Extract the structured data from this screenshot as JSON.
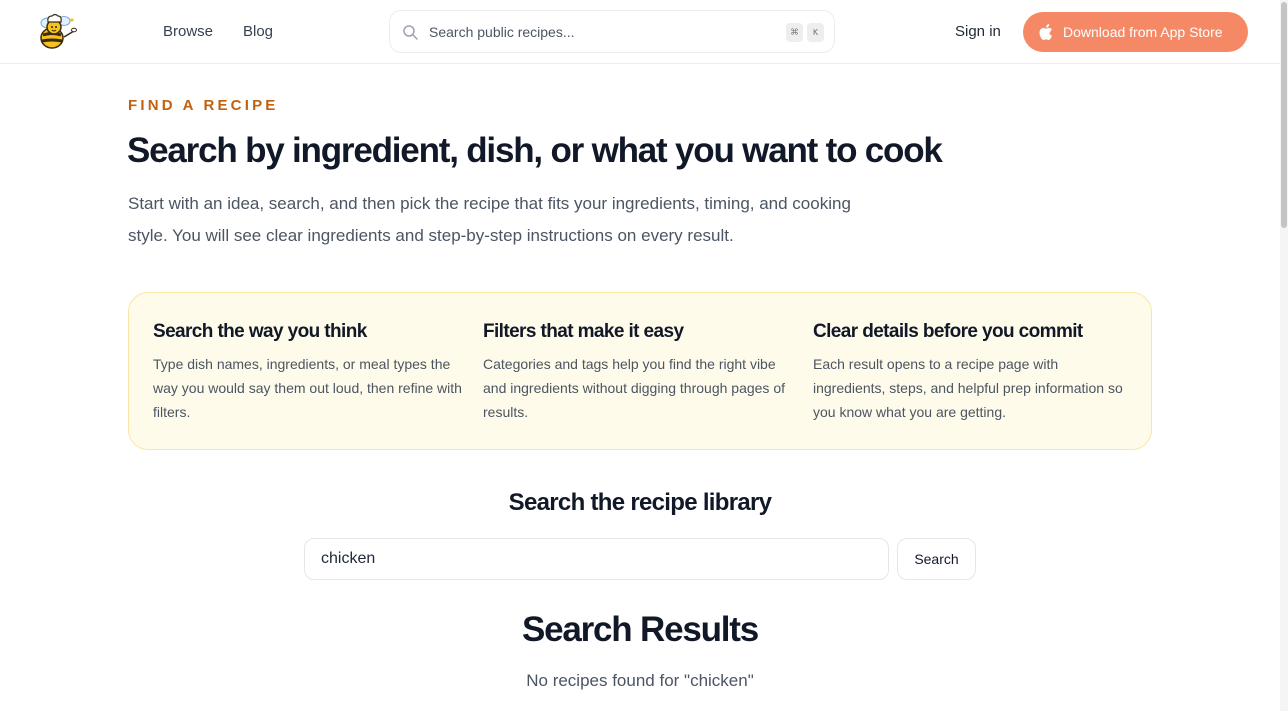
{
  "header": {
    "logo_icon": "bee-chef-logo",
    "nav": [
      {
        "label": "Browse"
      },
      {
        "label": "Blog"
      }
    ],
    "search": {
      "placeholder": "Search public recipes...",
      "icon": "search-icon",
      "shortcut_keys": [
        "⌘",
        "K"
      ]
    },
    "sign_in_label": "Sign in",
    "download": {
      "label": "Download from App Store",
      "icon": "apple-icon",
      "color": "#f58966"
    }
  },
  "hero": {
    "eyebrow": "FIND A RECIPE",
    "title": "Search by ingredient, dish, or what you want to cook",
    "subtitle": "Start with an idea, search, and then pick the recipe that fits your ingredients, timing, and cooking style. You will see clear ingredients and step-by-step instructions on every result.",
    "eyebrow_color": "#c2610e"
  },
  "features": [
    {
      "title": "Search the way you think",
      "text": "Type dish names, ingredients, or meal types the way you would say them out loud, then refine with filters."
    },
    {
      "title": "Filters that make it easy",
      "text": "Categories and tags help you find the right vibe and ingredients without digging through pages of results."
    },
    {
      "title": "Clear details before you commit",
      "text": "Each result opens to a recipe page with ingredients, steps, and helpful prep information so you know what you are getting."
    }
  ],
  "library": {
    "title": "Search the recipe library",
    "query": "chicken",
    "button_label": "Search"
  },
  "results": {
    "title": "Search Results",
    "empty_message": "No recipes found for \"chicken\""
  }
}
